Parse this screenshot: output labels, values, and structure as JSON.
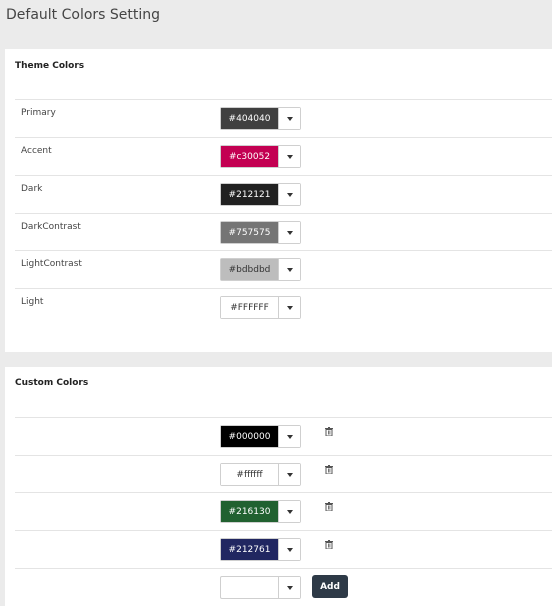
{
  "page_title": "Default Colors Setting",
  "theme": {
    "title": "Theme Colors",
    "items": [
      {
        "label": "Primary",
        "value": "#404040",
        "bg": "#404040",
        "fg": "#ffffff"
      },
      {
        "label": "Accent",
        "value": "#c30052",
        "bg": "#c30052",
        "fg": "#ffffff"
      },
      {
        "label": "Dark",
        "value": "#212121",
        "bg": "#212121",
        "fg": "#ffffff"
      },
      {
        "label": "DarkContrast",
        "value": "#757575",
        "bg": "#757575",
        "fg": "#ffffff"
      },
      {
        "label": "LightContrast",
        "value": "#bdbdbd",
        "bg": "#bdbdbd",
        "fg": "#333333"
      },
      {
        "label": "Light",
        "value": "#FFFFFF",
        "bg": "#ffffff",
        "fg": "#333333"
      }
    ]
  },
  "custom": {
    "title": "Custom Colors",
    "items": [
      {
        "value": "#000000",
        "bg": "#000000",
        "fg": "#ffffff"
      },
      {
        "value": "#ffffff",
        "bg": "#ffffff",
        "fg": "#333333"
      },
      {
        "value": "#216130",
        "bg": "#216130",
        "fg": "#ffffff"
      },
      {
        "value": "#212761",
        "bg": "#212761",
        "fg": "#ffffff"
      }
    ],
    "new_value": "",
    "add_label": "Add"
  },
  "icons": {
    "caret": "caret-down-icon",
    "delete": "trash-icon"
  }
}
